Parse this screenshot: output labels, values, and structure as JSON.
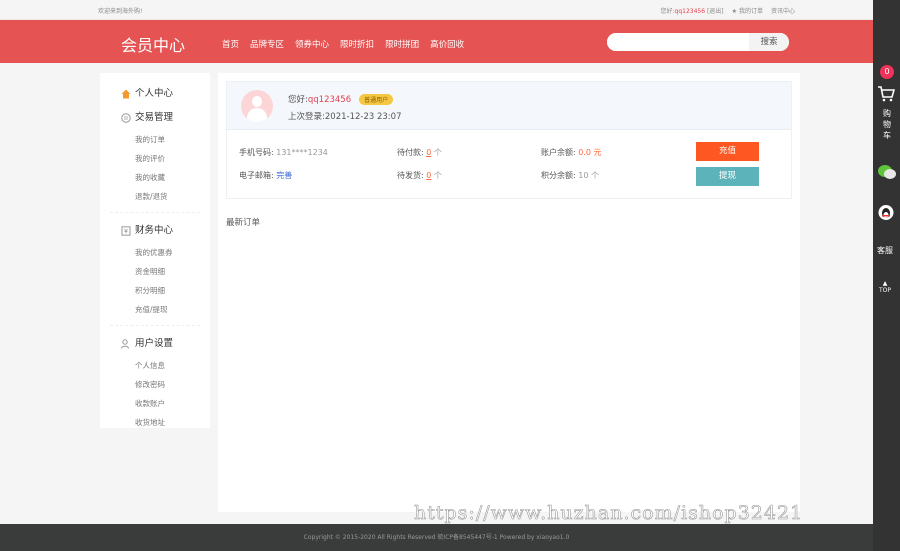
{
  "topbar": {
    "welcome": "欢迎来到海外购!",
    "greeting": "您好:",
    "username": "qq123456",
    "logout": "[退出]",
    "my_orders": "我的订单",
    "news": "资讯中心"
  },
  "header": {
    "title": "会员中心",
    "nav": [
      "首页",
      "品牌专区",
      "领券中心",
      "限时折扣",
      "限时拼团",
      "高价回收"
    ],
    "search_placeholder": "",
    "search_button": "搜索"
  },
  "sidebar": {
    "home": "个人中心",
    "sections": [
      {
        "title": "交易管理",
        "items": [
          "我的订单",
          "我的评价",
          "我的收藏",
          "退款/退货"
        ]
      },
      {
        "title": "财务中心",
        "items": [
          "我的优惠券",
          "资金明细",
          "积分明细",
          "充值/提现"
        ]
      },
      {
        "title": "用户设置",
        "items": [
          "个人信息",
          "修改密码",
          "收款账户",
          "收货地址"
        ]
      }
    ]
  },
  "profile": {
    "greeting": "您好:",
    "username": "qq123456",
    "level": "普通用户",
    "last_login_label": "上次登录:",
    "last_login": "2021-12-23 23:07",
    "phone_label": "手机号码:",
    "phone": "131****1234",
    "email_label": "电子邮箱:",
    "email": "完善",
    "pending_pay_label": "待付款:",
    "pending_pay": "0",
    "pending_ship_label": "待发货:",
    "pending_ship": "0",
    "unit": "个",
    "balance_label": "账户余额:",
    "balance": "0.0 元",
    "points_label": "积分余额:",
    "points": "10 个",
    "recharge": "充值",
    "withdraw": "提现"
  },
  "recent_orders": "最新订单",
  "footer": "Copyright © 2015-2020 All Rights Reserved 皖ICP备8545447号-1   Powered by xiaoyao1.0",
  "watermark": "https://www.huzhan.com/ishop32421",
  "rightbar": {
    "cart_count": "0",
    "cart": "购物车",
    "service": "客服",
    "top": "TOP"
  },
  "colors": {
    "brand": "#e55353",
    "recharge": "#ff5722",
    "withdraw": "#5cb3b9"
  }
}
